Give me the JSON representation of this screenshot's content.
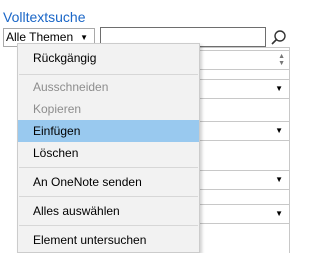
{
  "page": {
    "title": "Volltextsuche",
    "themen_select": {
      "value": "Alle Themen"
    },
    "search": {
      "value": "",
      "placeholder": ""
    }
  },
  "context_menu": {
    "items": [
      {
        "label": "Rückgängig",
        "enabled": true
      },
      {
        "label": "Ausschneiden",
        "enabled": false
      },
      {
        "label": "Kopieren",
        "enabled": false
      },
      {
        "label": "Einfügen",
        "enabled": true,
        "highlighted": true
      },
      {
        "label": "Löschen",
        "enabled": true
      },
      {
        "label": "An OneNote senden",
        "enabled": true
      },
      {
        "label": "Alles auswählen",
        "enabled": true
      },
      {
        "label": "Element untersuchen",
        "enabled": true
      }
    ]
  },
  "colors": {
    "title": "#1a66c7",
    "menu_highlight": "#99c9ef",
    "menu_background": "#f2f2f2",
    "disabled_text": "#8d8d8d"
  }
}
